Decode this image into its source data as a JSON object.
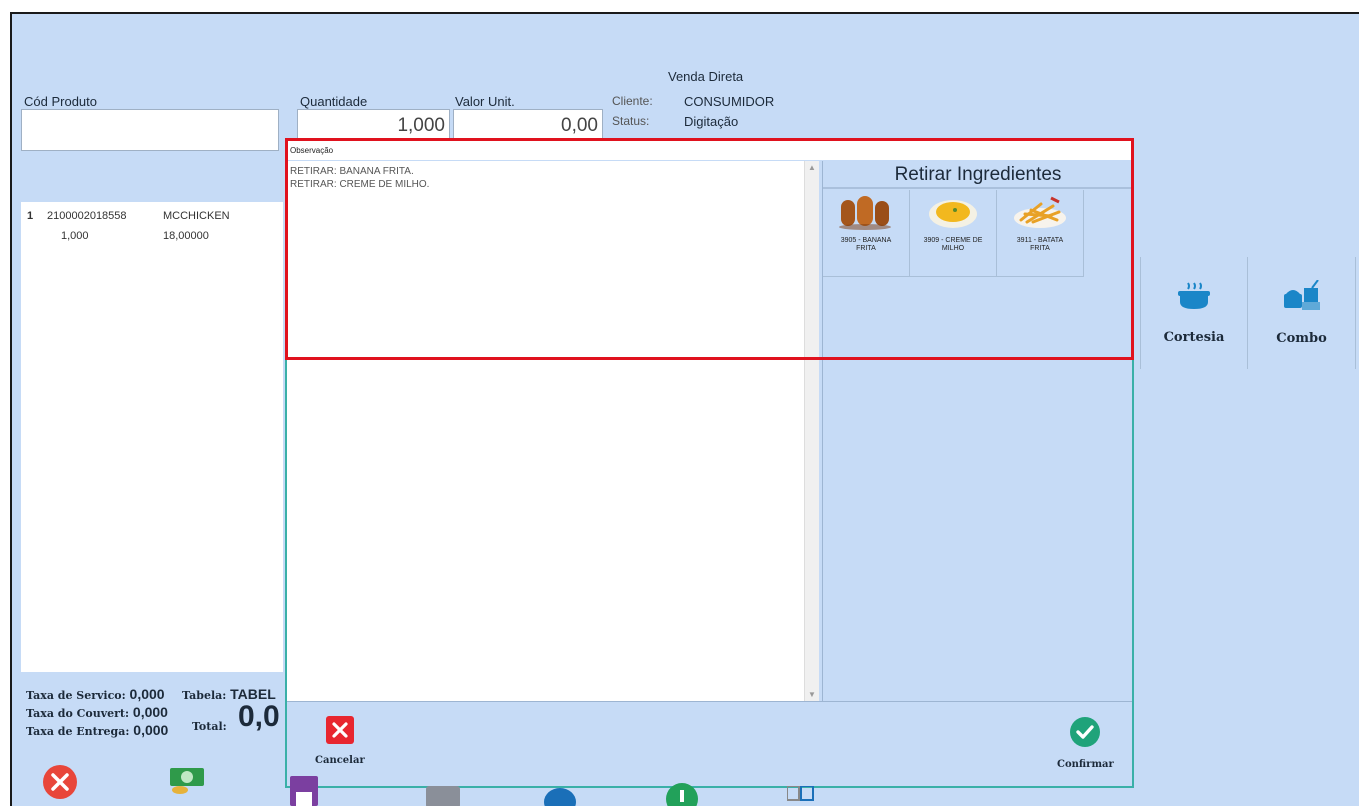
{
  "header": {
    "venda_title": "Venda Direta",
    "cliente_label": "Cliente:",
    "cliente_value": "CONSUMIDOR",
    "status_label": "Status:",
    "status_value": "Digitação"
  },
  "form": {
    "cod_produto_label": "Cód Produto",
    "quantidade_label": "Quantidade",
    "quantidade_value": "1,000",
    "valor_unit_label": "Valor Unit.",
    "valor_unit_value": "0,00"
  },
  "items": [
    {
      "index": "1",
      "code": "2100002018558",
      "name": "MCCHICKEN",
      "qty": "1,000",
      "price": "18,00000"
    }
  ],
  "totals": {
    "taxa_servico_label": "Taxa de Servico:",
    "taxa_servico_value": "0,000",
    "taxa_couvert_label": "Taxa do Couvert:",
    "taxa_couvert_value": "0,000",
    "taxa_entrega_label": "Taxa de Entrega:",
    "taxa_entrega_value": "0,000",
    "tabela_label": "Tabela:",
    "tabela_value": "TABEL",
    "total_label": "Total:",
    "total_value": "0,0"
  },
  "actions": [
    {
      "label": "Cortesia",
      "icon": "cortesia-icon"
    },
    {
      "label": "Combo",
      "icon": "combo-icon"
    }
  ],
  "dialog": {
    "obs_label": "Observação",
    "obs_text": "RETIRAR: BANANA FRITA.\nRETIRAR: CREME DE MILHO.",
    "ingredients_title": "Retirar Ingredientes",
    "ingredients": [
      {
        "label": "3905 - BANANA\nFRITA",
        "icon": "banana-frita-image"
      },
      {
        "label": "3909 - CREME DE\nMILHO",
        "icon": "creme-de-milho-image"
      },
      {
        "label": "3911 - BATATA\nFRITA",
        "icon": "batata-frita-image"
      }
    ],
    "cancel_label": "Cancelar",
    "confirm_label": "Confirmar"
  },
  "colors": {
    "background": "#c6dbf6",
    "highlight": "#e0121e",
    "dialog_border": "#3ab0a8",
    "cancel": "#e8262f",
    "confirm": "#1fa37a",
    "icon_blue": "#1a86c8"
  }
}
